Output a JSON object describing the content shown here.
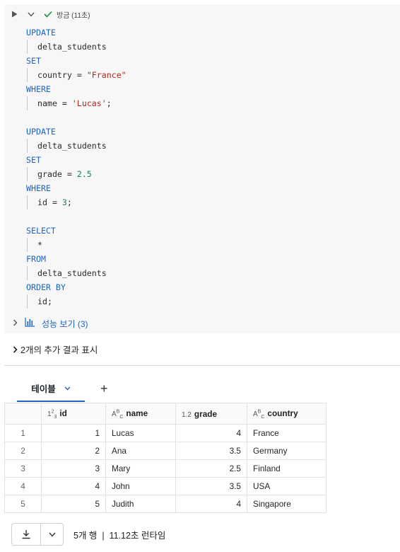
{
  "cell": {
    "status": "방금 (11초)",
    "code_lines": [
      {
        "kind": "kw",
        "text": "UPDATE"
      },
      {
        "kind": "ident",
        "text": "delta_students"
      },
      {
        "kind": "kw",
        "text": "SET"
      },
      {
        "kind": "expr",
        "parts": [
          {
            "t": "country = ",
            "c": "p"
          },
          {
            "t": "\"France\"",
            "c": "str"
          }
        ]
      },
      {
        "kind": "kw",
        "text": "WHERE"
      },
      {
        "kind": "expr",
        "parts": [
          {
            "t": "name = ",
            "c": "p"
          },
          {
            "t": "'Lucas'",
            "c": "str"
          },
          {
            "t": ";",
            "c": "p"
          }
        ]
      },
      {
        "kind": "blank"
      },
      {
        "kind": "kw",
        "text": "UPDATE"
      },
      {
        "kind": "ident",
        "text": "delta_students"
      },
      {
        "kind": "kw",
        "text": "SET"
      },
      {
        "kind": "expr",
        "parts": [
          {
            "t": "grade = ",
            "c": "p"
          },
          {
            "t": "2.5",
            "c": "num"
          }
        ]
      },
      {
        "kind": "kw",
        "text": "WHERE"
      },
      {
        "kind": "expr",
        "parts": [
          {
            "t": "id = ",
            "c": "p"
          },
          {
            "t": "3",
            "c": "num"
          },
          {
            "t": ";",
            "c": "p"
          }
        ]
      },
      {
        "kind": "blank"
      },
      {
        "kind": "kw",
        "text": "SELECT"
      },
      {
        "kind": "ident",
        "text": "*"
      },
      {
        "kind": "kw",
        "text": "FROM"
      },
      {
        "kind": "ident",
        "text": "delta_students"
      },
      {
        "kind": "kw",
        "text": "ORDER BY"
      },
      {
        "kind": "ident",
        "text": "id;"
      }
    ],
    "perf_label": "성능 보기 (3)"
  },
  "more_results": "2개의 추가 결과 표시",
  "tabs": {
    "active": "테이블",
    "add": "+"
  },
  "table": {
    "columns": [
      {
        "type": "1²₃",
        "label": "id"
      },
      {
        "type": "A^B_C",
        "label": "name"
      },
      {
        "type": "1.2",
        "label": "grade"
      },
      {
        "type": "A^B_C",
        "label": "country"
      }
    ],
    "rows": [
      {
        "n": "1",
        "id": "1",
        "name": "Lucas",
        "grade": "4",
        "country": "France"
      },
      {
        "n": "2",
        "id": "2",
        "name": "Ana",
        "grade": "3.5",
        "country": "Germany"
      },
      {
        "n": "3",
        "id": "3",
        "name": "Mary",
        "grade": "2.5",
        "country": "Finland"
      },
      {
        "n": "4",
        "id": "4",
        "name": "John",
        "grade": "3.5",
        "country": "USA"
      },
      {
        "n": "5",
        "id": "5",
        "name": "Judith",
        "grade": "4",
        "country": "Singapore"
      }
    ]
  },
  "footer": {
    "summary": "5개 행  |  11.12초 런타임"
  },
  "colors": {
    "accent": "#1d63c4",
    "success": "#1e8e3e",
    "keyword": "#1d63c4",
    "string": "#b1261b",
    "number": "#1a7f60"
  }
}
